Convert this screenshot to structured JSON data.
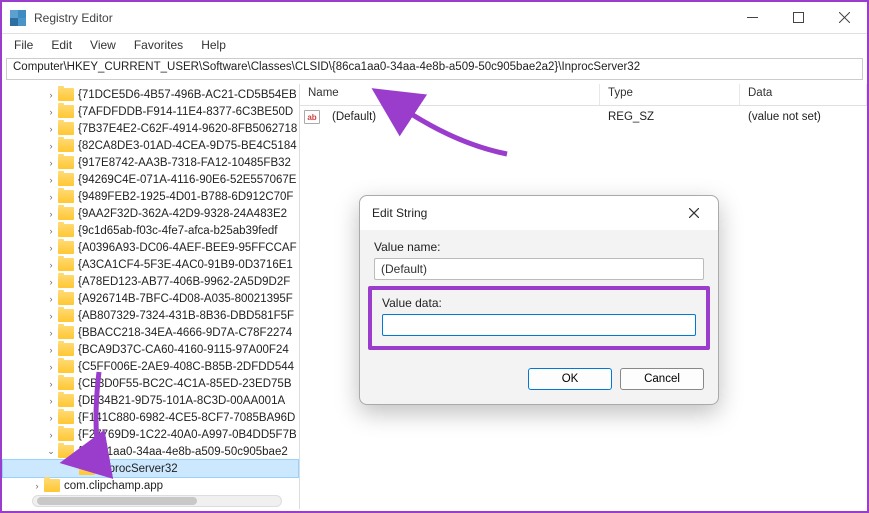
{
  "window": {
    "title": "Registry Editor"
  },
  "menu": {
    "file": "File",
    "edit": "Edit",
    "view": "View",
    "favorites": "Favorites",
    "help": "Help"
  },
  "address": "Computer\\HKEY_CURRENT_USER\\Software\\Classes\\CLSID\\{86ca1aa0-34aa-4e8b-a509-50c905bae2a2}\\InprocServer32",
  "tree": [
    {
      "label": "{71DCE5D6-4B57-496B-AC21-CD5B54EB"
    },
    {
      "label": "{7AFDFDDB-F914-11E4-8377-6C3BE50D"
    },
    {
      "label": "{7B37E4E2-C62F-4914-9620-8FB5062718"
    },
    {
      "label": "{82CA8DE3-01AD-4CEA-9D75-BE4C5184"
    },
    {
      "label": "{917E8742-AA3B-7318-FA12-10485FB32"
    },
    {
      "label": "{94269C4E-071A-4116-90E6-52E557067E"
    },
    {
      "label": "{9489FEB2-1925-4D01-B788-6D912C70F"
    },
    {
      "label": "{9AA2F32D-362A-42D9-9328-24A483E2"
    },
    {
      "label": "{9c1d65ab-f03c-4fe7-afca-b25ab39fedf"
    },
    {
      "label": "{A0396A93-DC06-4AEF-BEE9-95FFCCAF"
    },
    {
      "label": "{A3CA1CF4-5F3E-4AC0-91B9-0D3716E1"
    },
    {
      "label": "{A78ED123-AB77-406B-9962-2A5D9D2F"
    },
    {
      "label": "{A926714B-7BFC-4D08-A035-80021395F"
    },
    {
      "label": "{AB807329-7324-431B-8B36-DBD581F5F"
    },
    {
      "label": "{BBACC218-34EA-4666-9D7A-C78F2274"
    },
    {
      "label": "{BCA9D37C-CA60-4160-9115-97A00F24"
    },
    {
      "label": "{C5FF006E-2AE9-408C-B85B-2DFDD544"
    },
    {
      "label": "{CB3D0F55-BC2C-4C1A-85ED-23ED75B"
    },
    {
      "label": "{DE34B21-9D75-101A-8C3D-00AA001A"
    },
    {
      "label": "{F141C880-6982-4CE5-8CF7-7085BA96D"
    },
    {
      "label": "{F27769D9-1C22-40A0-A997-0B4DD5F7B"
    }
  ],
  "expanded_item": "{86ca1aa0-34aa-4e8b-a509-50c905bae2",
  "selected_item": "InprocServer32",
  "bottom_item": "com.clipchamp.app",
  "columns": {
    "name": "Name",
    "type": "Type",
    "data": "Data"
  },
  "row": {
    "name": "(Default)",
    "type": "REG_SZ",
    "data": "(value not set)"
  },
  "dialog": {
    "title": "Edit String",
    "valuename_label": "Value name:",
    "valuename": "(Default)",
    "valuedata_label": "Value data:",
    "valuedata": "",
    "ok": "OK",
    "cancel": "Cancel"
  }
}
